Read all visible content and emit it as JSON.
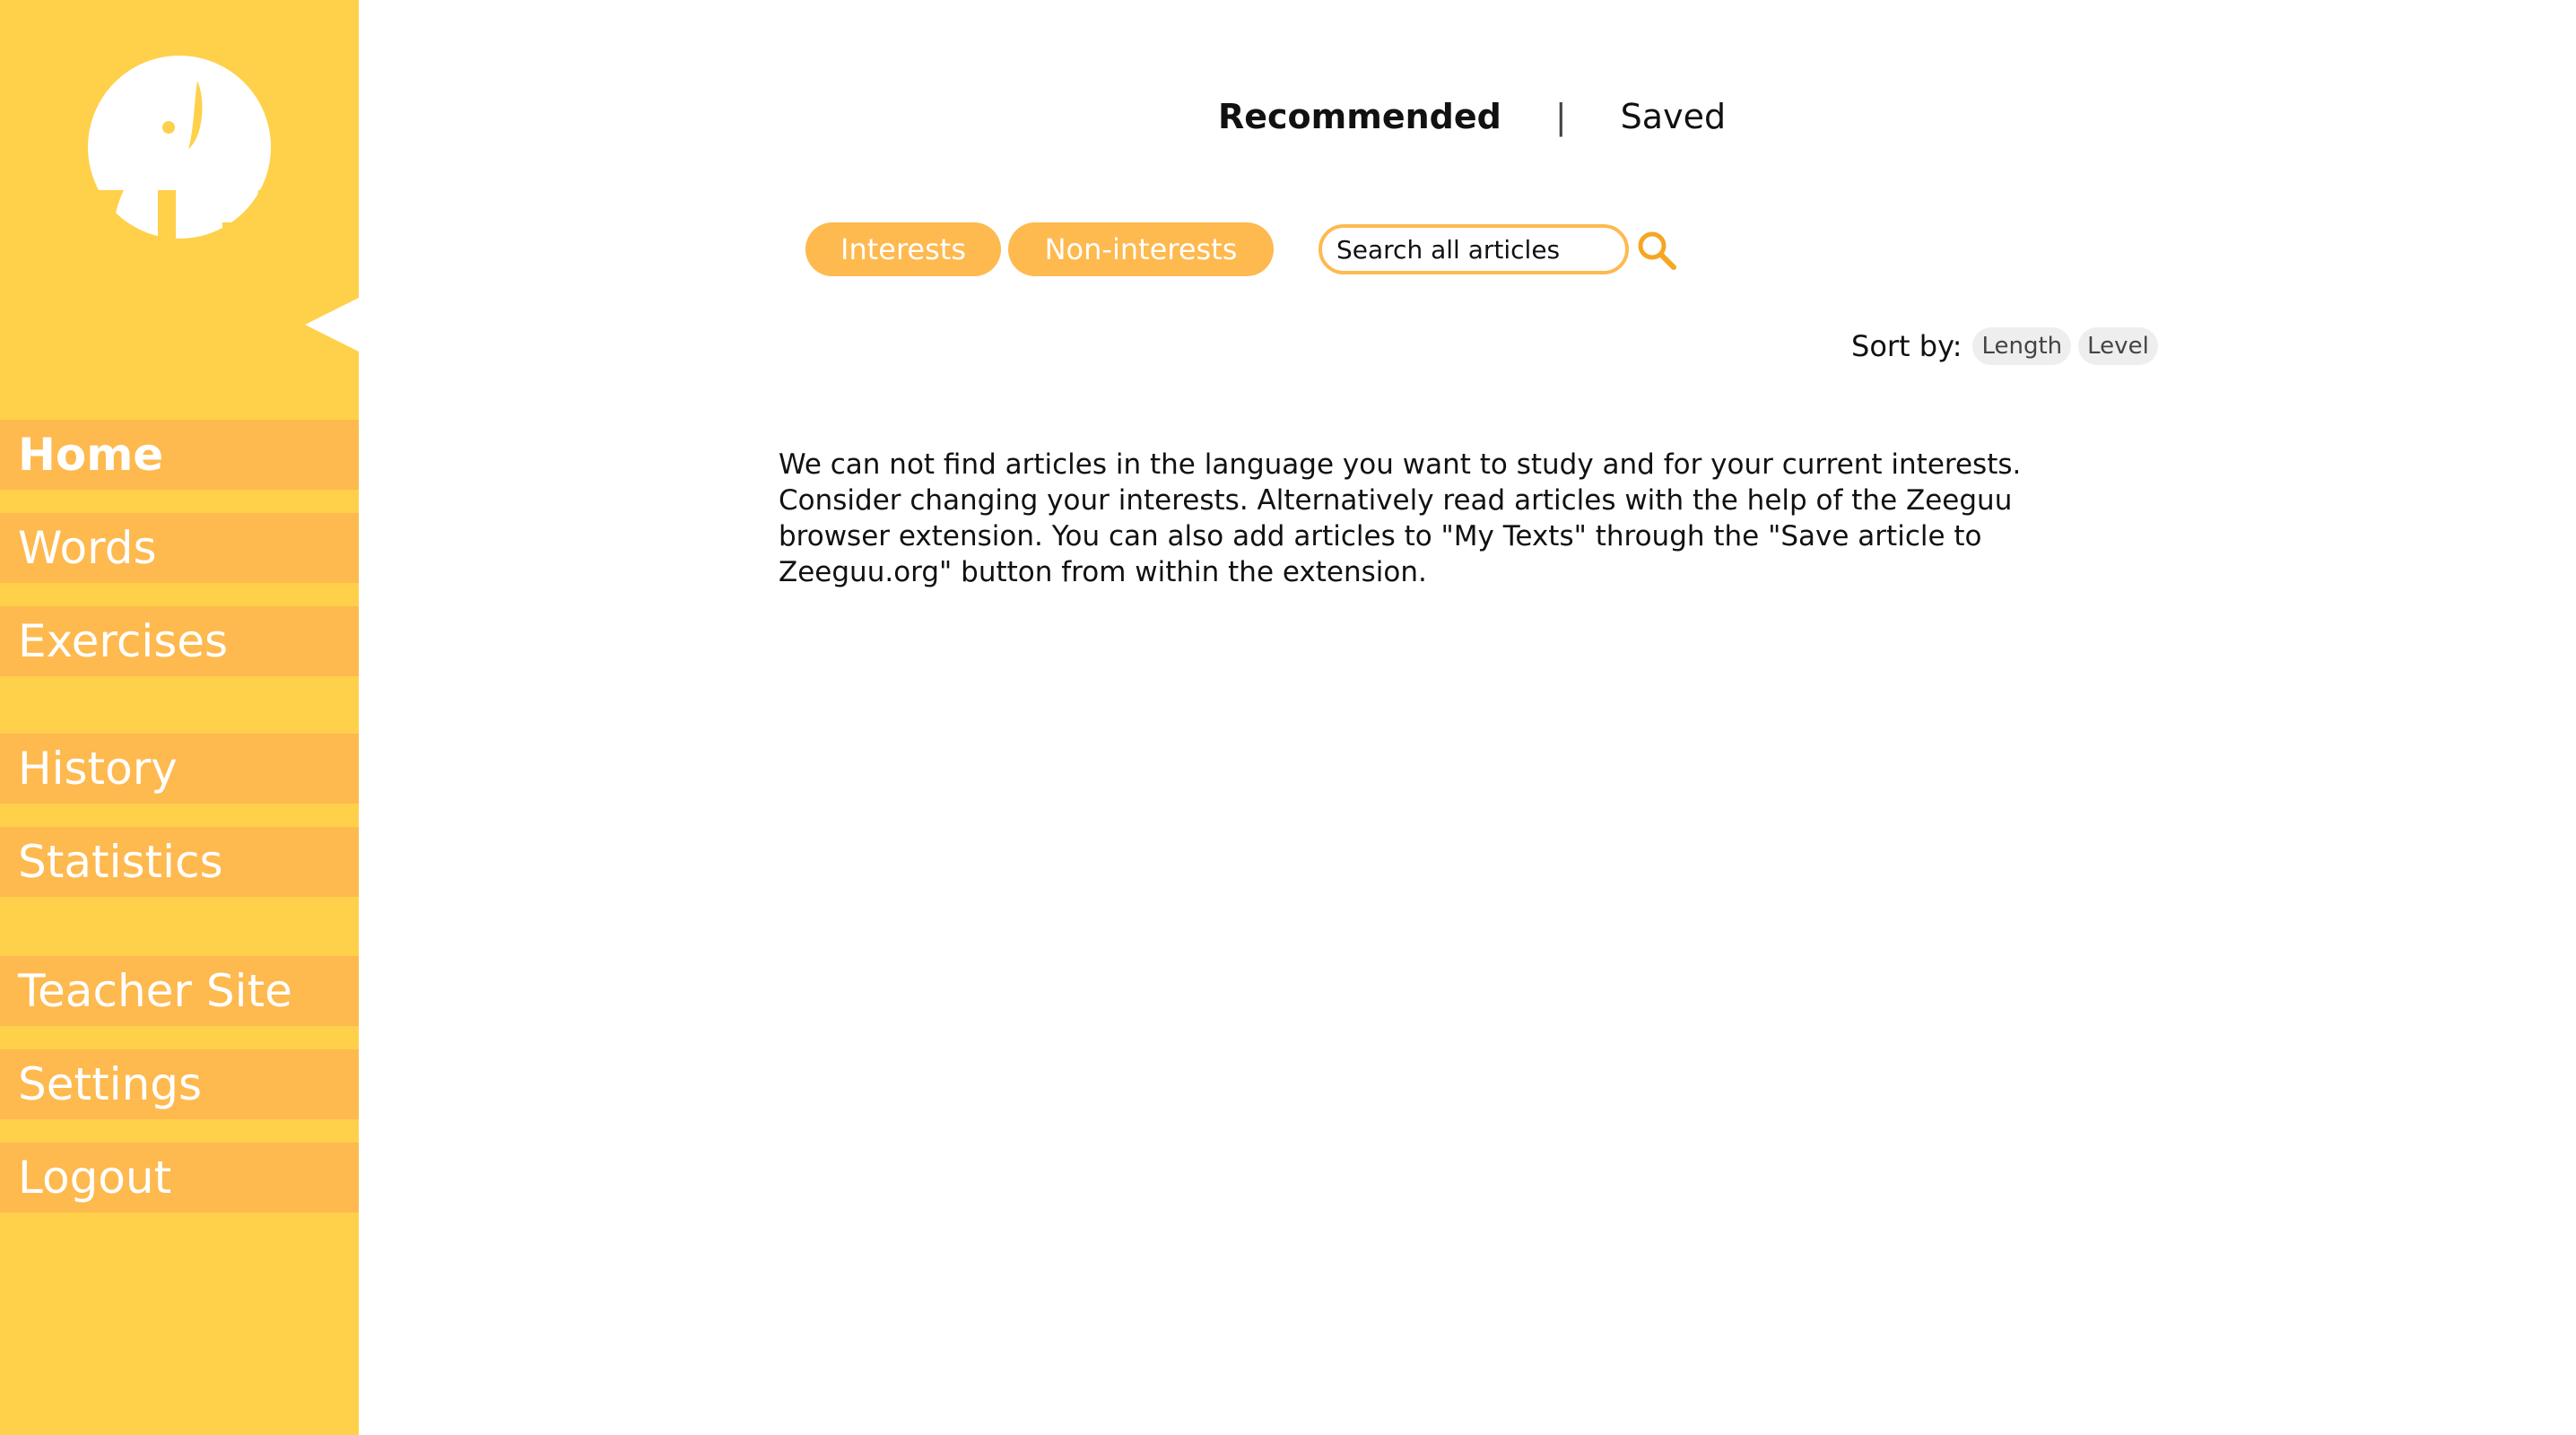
{
  "sidebar": {
    "logo_icon": "elephant-logo-icon",
    "items": [
      {
        "label": "Home"
      },
      {
        "label": "Words"
      },
      {
        "label": "Exercises"
      },
      {
        "label": "History"
      },
      {
        "label": "Statistics"
      },
      {
        "label": "Teacher Site"
      },
      {
        "label": "Settings"
      },
      {
        "label": "Logout"
      }
    ]
  },
  "tabs": {
    "recommended": "Recommended",
    "separator": "|",
    "saved": "Saved"
  },
  "filters": {
    "interests": "Interests",
    "non_interests": "Non-interests"
  },
  "search": {
    "placeholder": "Search all articles"
  },
  "sort": {
    "label": "Sort by:",
    "length": "Length",
    "level": "Level"
  },
  "message": "We can not find articles in the language you want to study and for your current interests. Consider changing your interests. Alternatively read articles with the help of the Zeeguu browser extension. You can also add articles to \"My Texts\" through the \"Save article to Zeeguu.org\" button from within the extension.",
  "colors": {
    "sidebar_bg": "#ffd04a",
    "accent": "#feb94f",
    "search_icon": "#f5a623",
    "text": "#111111"
  }
}
